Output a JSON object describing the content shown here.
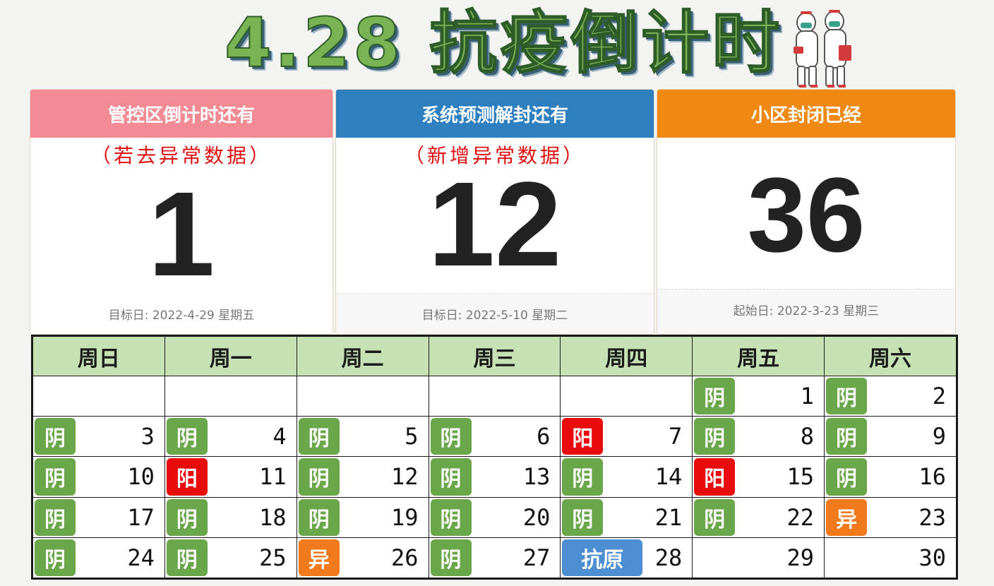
{
  "banner": {
    "title": "4.28 抗疫倒计时"
  },
  "cards": [
    {
      "header": "管控区倒计时还有",
      "note": "（若去异常数据）",
      "number": "1",
      "footer": "目标日: 2022-4-29 星期五"
    },
    {
      "header": "系统预测解封还有",
      "note": "（新增异常数据）",
      "number": "12",
      "footer": "目标日: 2022-5-10 星期二"
    },
    {
      "header": "小区封闭已经",
      "note": "",
      "number": "36",
      "footer": "起始日: 2022-3-23 星期三"
    }
  ],
  "colors": {
    "negative": "#6aa64a",
    "positive": "#e80c0c",
    "abnormal": "#f07a1c",
    "antigen": "#4d8ed2",
    "card1_header": "#f28a94",
    "card2_header": "#2d7fc0",
    "card3_header": "#ee8a14",
    "weekday_header": "#c6e2b4"
  },
  "calendar": {
    "weekdays": [
      "周日",
      "周一",
      "周二",
      "周三",
      "周四",
      "周五",
      "周六"
    ],
    "weeks": [
      [
        {
          "day": "",
          "status": ""
        },
        {
          "day": "",
          "status": ""
        },
        {
          "day": "",
          "status": ""
        },
        {
          "day": "",
          "status": ""
        },
        {
          "day": "",
          "status": ""
        },
        {
          "day": "1",
          "status": "阴",
          "kind": "neg"
        },
        {
          "day": "2",
          "status": "阴",
          "kind": "neg"
        }
      ],
      [
        {
          "day": "3",
          "status": "阴",
          "kind": "neg"
        },
        {
          "day": "4",
          "status": "阴",
          "kind": "neg"
        },
        {
          "day": "5",
          "status": "阴",
          "kind": "neg"
        },
        {
          "day": "6",
          "status": "阴",
          "kind": "neg"
        },
        {
          "day": "7",
          "status": "阳",
          "kind": "pos"
        },
        {
          "day": "8",
          "status": "阴",
          "kind": "neg"
        },
        {
          "day": "9",
          "status": "阴",
          "kind": "neg"
        }
      ],
      [
        {
          "day": "10",
          "status": "阴",
          "kind": "neg"
        },
        {
          "day": "11",
          "status": "阳",
          "kind": "pos"
        },
        {
          "day": "12",
          "status": "阴",
          "kind": "neg"
        },
        {
          "day": "13",
          "status": "阴",
          "kind": "neg"
        },
        {
          "day": "14",
          "status": "阴",
          "kind": "neg"
        },
        {
          "day": "15",
          "status": "阳",
          "kind": "pos"
        },
        {
          "day": "16",
          "status": "阴",
          "kind": "neg"
        }
      ],
      [
        {
          "day": "17",
          "status": "阴",
          "kind": "neg"
        },
        {
          "day": "18",
          "status": "阴",
          "kind": "neg"
        },
        {
          "day": "19",
          "status": "阴",
          "kind": "neg"
        },
        {
          "day": "20",
          "status": "阴",
          "kind": "neg"
        },
        {
          "day": "21",
          "status": "阴",
          "kind": "neg"
        },
        {
          "day": "22",
          "status": "阴",
          "kind": "neg"
        },
        {
          "day": "23",
          "status": "异",
          "kind": "abn"
        }
      ],
      [
        {
          "day": "24",
          "status": "阴",
          "kind": "neg"
        },
        {
          "day": "25",
          "status": "阴",
          "kind": "neg"
        },
        {
          "day": "26",
          "status": "异",
          "kind": "abn"
        },
        {
          "day": "27",
          "status": "阴",
          "kind": "neg"
        },
        {
          "day": "28",
          "status": "抗原",
          "kind": "ag"
        },
        {
          "day": "29",
          "status": ""
        },
        {
          "day": "30",
          "status": ""
        }
      ]
    ]
  }
}
